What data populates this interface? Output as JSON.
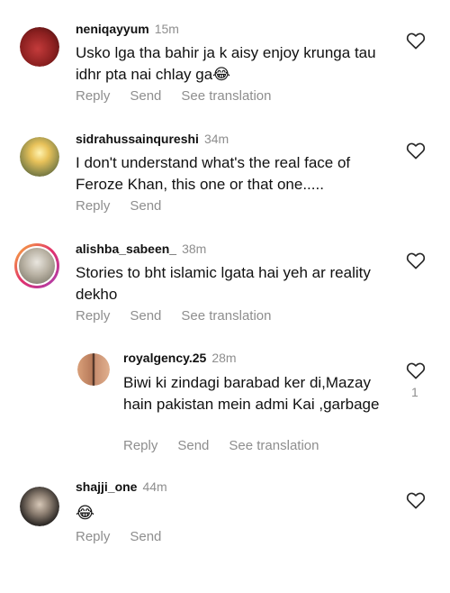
{
  "comments": [
    {
      "username": "neniqayyum",
      "time": "15m",
      "text": "Usko lga tha bahir ja k aisy enjoy krunga tau idhr pta nai chlay ga😂",
      "reply": "Reply",
      "send": "Send",
      "translate": "See translation"
    },
    {
      "username": "sidrahussainqureshi",
      "time": "34m",
      "text": "I don't understand what's the real face of Feroze Khan, this one or that one.....",
      "reply": "Reply",
      "send": "Send"
    },
    {
      "username": "alishba_sabeen_",
      "time": "38m",
      "text": "Stories to bht islamic lgata hai yeh ar reality dekho",
      "reply": "Reply",
      "send": "Send",
      "translate": "See translation"
    },
    {
      "username": "royalgency.25",
      "time": "28m",
      "text": "Biwi ki zindagi barabad ker di,Mazay hain pakistan mein admi Kai ,garbage",
      "reply": "Reply",
      "send": "Send",
      "translate": "See translation",
      "likes": "1"
    },
    {
      "username": "shajji_one",
      "time": "44m",
      "text": "😂",
      "reply": "Reply",
      "send": "Send"
    }
  ],
  "colors": {
    "secondary_text": "#8e8e8e",
    "story_ring": [
      "#f9b43a",
      "#e1306c",
      "#a53fb6"
    ]
  },
  "icons": {
    "like": "heart-outline-icon"
  }
}
